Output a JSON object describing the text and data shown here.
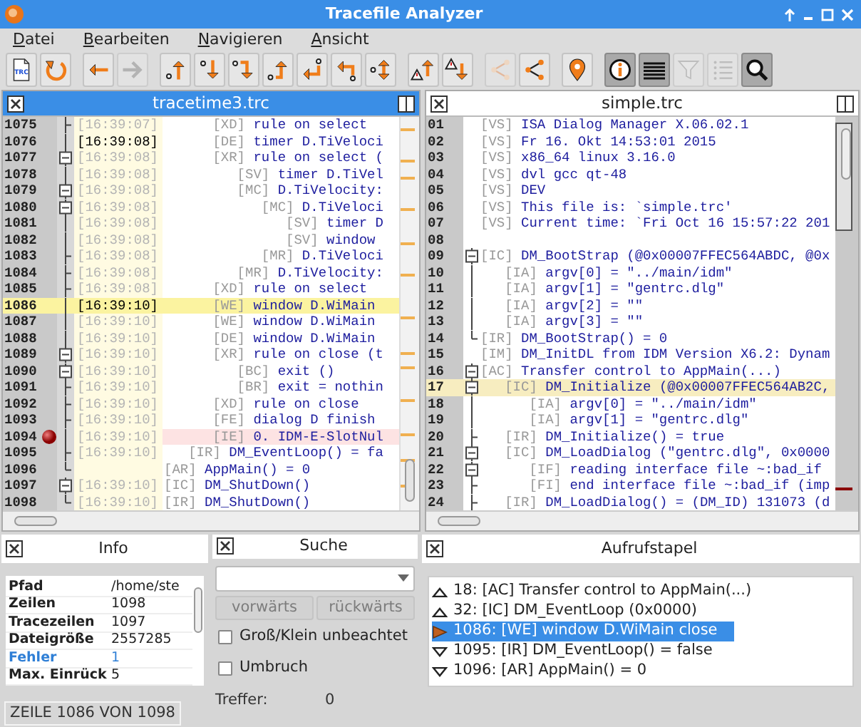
{
  "window": {
    "title": "Tracefile Analyzer"
  },
  "menu": [
    "Datei",
    "Bearbeiten",
    "Navigieren",
    "Ansicht"
  ],
  "toolbar": [
    [
      {
        "kind": "file",
        "label": "TRC",
        "pressed": false,
        "disabled": false
      },
      {
        "kind": "reload",
        "pressed": false,
        "disabled": false
      }
    ],
    [
      {
        "kind": "back",
        "pressed": false,
        "disabled": false
      },
      {
        "kind": "forward",
        "pressed": false,
        "disabled": true
      }
    ],
    [
      {
        "kind": "up-step",
        "pressed": false,
        "disabled": false
      },
      {
        "kind": "down-step",
        "pressed": false,
        "disabled": false
      },
      {
        "kind": "down-hook",
        "pressed": false,
        "disabled": false
      },
      {
        "kind": "up-hook",
        "pressed": false,
        "disabled": false
      },
      {
        "kind": "return",
        "pressed": false,
        "disabled": false
      },
      {
        "kind": "back-hook",
        "pressed": false,
        "disabled": false
      },
      {
        "kind": "updown",
        "pressed": false,
        "disabled": false
      }
    ],
    [
      {
        "kind": "warn-up",
        "pressed": false,
        "disabled": false
      },
      {
        "kind": "warn-down",
        "pressed": false,
        "disabled": false
      }
    ],
    [
      {
        "kind": "share",
        "pressed": false,
        "disabled": true
      },
      {
        "kind": "share",
        "pressed": false,
        "disabled": false
      }
    ],
    [
      {
        "kind": "pin",
        "pressed": false,
        "disabled": false
      }
    ],
    [
      {
        "kind": "info",
        "pressed": true,
        "disabled": false
      },
      {
        "kind": "lines",
        "pressed": true,
        "disabled": false
      },
      {
        "kind": "filter",
        "pressed": false,
        "disabled": true
      },
      {
        "kind": "list",
        "pressed": false,
        "disabled": true
      },
      {
        "kind": "search",
        "pressed": true,
        "disabled": false
      }
    ]
  ],
  "left_pane": {
    "title": "tracetime3.trc",
    "active": true,
    "rows": [
      {
        "num": "1075",
        "time": "[16:39:07]",
        "time_dim": true,
        "kind": "tick",
        "tag": "      [XD]",
        "text": "rule on select",
        "current": false,
        "error": false,
        "breakpoint": false
      },
      {
        "num": "1076",
        "time": "[16:39:08]",
        "time_dim": false,
        "kind": "line",
        "tag": "      [DE]",
        "text": "timer D.TiVeloci",
        "current": false,
        "error": false,
        "breakpoint": false
      },
      {
        "num": "1077",
        "time": "[16:39:08]",
        "time_dim": true,
        "kind": "box",
        "tag": "      [XR]",
        "text": "rule on select (",
        "current": false,
        "error": false,
        "breakpoint": false
      },
      {
        "num": "1078",
        "time": "[16:39:08]",
        "time_dim": true,
        "kind": "line",
        "tag": "         [SV]",
        "text": "timer D.TiVel",
        "current": false,
        "error": false,
        "breakpoint": false
      },
      {
        "num": "1079",
        "time": "[16:39:08]",
        "time_dim": true,
        "kind": "box",
        "tag": "         [MC]",
        "text": "D.TiVelocity:",
        "current": false,
        "error": false,
        "breakpoint": false
      },
      {
        "num": "1080",
        "time": "[16:39:08]",
        "time_dim": true,
        "kind": "box",
        "tag": "            [MC]",
        "text": "D.TiVeloci",
        "current": false,
        "error": false,
        "breakpoint": false
      },
      {
        "num": "1081",
        "time": "[16:39:08]",
        "time_dim": true,
        "kind": "line",
        "tag": "               [SV]",
        "text": "timer D",
        "current": false,
        "error": false,
        "breakpoint": false
      },
      {
        "num": "1082",
        "time": "[16:39:08]",
        "time_dim": true,
        "kind": "line",
        "tag": "               [SV]",
        "text": "window",
        "current": false,
        "error": false,
        "breakpoint": false
      },
      {
        "num": "1083",
        "time": "[16:39:08]",
        "time_dim": true,
        "kind": "tick",
        "tag": "            [MR]",
        "text": "D.TiVeloci",
        "current": false,
        "error": false,
        "breakpoint": false
      },
      {
        "num": "1084",
        "time": "[16:39:08]",
        "time_dim": true,
        "kind": "tick",
        "tag": "         [MR]",
        "text": "D.TiVelocity:",
        "current": false,
        "error": false,
        "breakpoint": false
      },
      {
        "num": "1085",
        "time": "[16:39:08]",
        "time_dim": true,
        "kind": "tick",
        "tag": "      [XD]",
        "text": "rule on select",
        "current": false,
        "error": false,
        "breakpoint": false
      },
      {
        "num": "1086",
        "time": "[16:39:10]",
        "time_dim": false,
        "kind": "line",
        "tag": "      [WE]",
        "text": "window D.WiMain",
        "current": true,
        "error": false,
        "breakpoint": false
      },
      {
        "num": "1087",
        "time": "[16:39:10]",
        "time_dim": true,
        "kind": "line",
        "tag": "      [WE]",
        "text": "window D.WiMain",
        "current": false,
        "error": false,
        "breakpoint": false
      },
      {
        "num": "1088",
        "time": "[16:39:10]",
        "time_dim": true,
        "kind": "line",
        "tag": "      [DE]",
        "text": "window D.WiMain",
        "current": false,
        "error": false,
        "breakpoint": false
      },
      {
        "num": "1089",
        "time": "[16:39:10]",
        "time_dim": true,
        "kind": "box",
        "tag": "      [XR]",
        "text": "rule on close (t",
        "current": false,
        "error": false,
        "breakpoint": false
      },
      {
        "num": "1090",
        "time": "[16:39:10]",
        "time_dim": true,
        "kind": "box",
        "tag": "         [BC]",
        "text": "exit ()",
        "current": false,
        "error": false,
        "breakpoint": false
      },
      {
        "num": "1091",
        "time": "[16:39:10]",
        "time_dim": true,
        "kind": "tick",
        "tag": "         [BR]",
        "text": "exit = nothin",
        "current": false,
        "error": false,
        "breakpoint": false
      },
      {
        "num": "1092",
        "time": "[16:39:10]",
        "time_dim": true,
        "kind": "tick",
        "tag": "      [XD]",
        "text": "rule on close",
        "current": false,
        "error": false,
        "breakpoint": false
      },
      {
        "num": "1093",
        "time": "[16:39:10]",
        "time_dim": true,
        "kind": "tick",
        "tag": "      [FE]",
        "text": "dialog D finish",
        "current": false,
        "error": false,
        "breakpoint": false
      },
      {
        "num": "1094",
        "time": "[16:39:10]",
        "time_dim": true,
        "kind": "line",
        "tag": "      [IE]",
        "text": "0. IDM-E-SlotNul",
        "current": false,
        "error": true,
        "breakpoint": true
      },
      {
        "num": "1095",
        "time": "[16:39:10]",
        "time_dim": true,
        "kind": "tick",
        "tag": "   [IR]",
        "text": "DM_EventLoop() = fa",
        "current": false,
        "error": false,
        "breakpoint": false
      },
      {
        "num": "1096",
        "kind": "end",
        "tag": "[AR]",
        "text": "AppMain() = 0",
        "current": false,
        "error": false,
        "breakpoint": false
      },
      {
        "num": "1097",
        "time": "[16:39:10]",
        "time_dim": true,
        "kind": "box",
        "tag": "[IC]",
        "text": "DM_ShutDown()",
        "current": false,
        "error": false,
        "breakpoint": false
      },
      {
        "num": "1098",
        "time": "[16:39:10]",
        "time_dim": true,
        "kind": "end",
        "tag": "[IR]",
        "text": "DM_ShutDown()",
        "current": false,
        "error": false,
        "breakpoint": false
      }
    ]
  },
  "right_pane": {
    "title": "simple.trc",
    "active": false,
    "rows": [
      {
        "num": "01",
        "kind": "none",
        "tag": "[VS]",
        "text": "ISA Dialog Manager X.06.02.1",
        "current": false
      },
      {
        "num": "02",
        "kind": "none",
        "tag": "[VS]",
        "text": "Fr 16. Okt 14:53:01 2015",
        "current": false
      },
      {
        "num": "03",
        "kind": "none",
        "tag": "[VS]",
        "text": "x86_64 linux 3.16.0",
        "current": false
      },
      {
        "num": "04",
        "kind": "none",
        "tag": "[VS]",
        "text": "dvl gcc qt-48",
        "current": false
      },
      {
        "num": "05",
        "kind": "none",
        "tag": "[VS]",
        "text": "DEV",
        "current": false
      },
      {
        "num": "06",
        "kind": "none",
        "tag": "[VS]",
        "text": "This file is: `simple.trc'",
        "current": false
      },
      {
        "num": "07",
        "kind": "none",
        "tag": "[VS]",
        "text": "Current time: `Fri Oct 16 15:57:22 201",
        "current": false
      },
      {
        "num": "08",
        "kind": "none",
        "current": false
      },
      {
        "num": "09",
        "kind": "box",
        "tag": "[IC]",
        "text": "DM_BootStrap (@0x00007FFEC564ABDC, @0x",
        "current": false
      },
      {
        "num": "10",
        "kind": "line",
        "tag": "   [IA]",
        "text": "argv[0] = \"../main/idm\"",
        "current": false
      },
      {
        "num": "11",
        "kind": "line",
        "tag": "   [IA]",
        "text": "argv[1] = \"gentrc.dlg\"",
        "current": false
      },
      {
        "num": "12",
        "kind": "line",
        "tag": "   [IA]",
        "text": "argv[2] = \"\"",
        "current": false
      },
      {
        "num": "13",
        "kind": "line",
        "tag": "   [IA]",
        "text": "argv[3] = \"\"",
        "current": false
      },
      {
        "num": "14",
        "kind": "end",
        "tag": "[IR]",
        "text": "DM_BootStrap() = 0",
        "current": false
      },
      {
        "num": "15",
        "kind": "none",
        "tag": "[IM]",
        "text": "DM_InitDL from IDM Version X6.2: Dynam",
        "current": false
      },
      {
        "num": "16",
        "kind": "box",
        "tag": "[AC]",
        "text": "Transfer control to AppMain(...)",
        "current": false
      },
      {
        "num": "17",
        "kind": "box",
        "tag": "   [IC]",
        "text": "DM_Initialize (@0x00007FFEC564AB2C,",
        "current": true
      },
      {
        "num": "18",
        "kind": "line",
        "tag": "      [IA]",
        "text": "argv[0] = \"../main/idm\"",
        "current": false
      },
      {
        "num": "19",
        "kind": "line",
        "tag": "      [IA]",
        "text": "argv[1] = \"gentrc.dlg\"",
        "current": false
      },
      {
        "num": "20",
        "kind": "tick",
        "tag": "   [IR]",
        "text": "DM_Initialize() = true",
        "current": false
      },
      {
        "num": "21",
        "kind": "box",
        "tag": "   [IC]",
        "text": "DM_LoadDialog (\"gentrc.dlg\", 0x0000",
        "current": false
      },
      {
        "num": "22",
        "kind": "box",
        "tag": "      [IF]",
        "text": "reading interface file ~:bad_if",
        "current": false
      },
      {
        "num": "23",
        "kind": "tick",
        "tag": "      [FI]",
        "text": "end interface file ~:bad_if (imp",
        "current": false
      },
      {
        "num": "24",
        "kind": "tick",
        "tag": "   [IR]",
        "text": "DM_LoadDialog() = (DM_ID) 131073 (d",
        "current": false
      }
    ]
  },
  "info": {
    "title": "Info",
    "rows": [
      {
        "label": "Pfad",
        "value": "/home/ste",
        "alert": false
      },
      {
        "label": "Zeilen",
        "value": "1098",
        "alert": false
      },
      {
        "label": "Tracezeilen",
        "value": "1097",
        "alert": false
      },
      {
        "label": "Dateigröße",
        "value": "2557285",
        "alert": false
      },
      {
        "label": "Fehler",
        "value": "1",
        "alert": true
      },
      {
        "label": "Max. Einrück",
        "value": "5",
        "alert": false
      }
    ]
  },
  "search": {
    "title": "Suche",
    "buttons": [
      {
        "label": "vorwärts",
        "disabled": true
      },
      {
        "label": "rückwärts",
        "disabled": true
      }
    ],
    "options": [
      {
        "label": "Groß/Klein unbeachtet",
        "checked": false
      },
      {
        "label": "Umbruch",
        "checked": false
      }
    ],
    "hits_label": "Treffer:",
    "hits": "0"
  },
  "call_stack": {
    "title": "Aufrufstapel",
    "items": [
      {
        "text": "18: [AC] Transfer control to AppMain(...)",
        "kind": "up",
        "selected": false
      },
      {
        "text": "32: [IC] DM_EventLoop (0x0000)",
        "kind": "up",
        "selected": false
      },
      {
        "text": "1086: [WE] window D.WiMain close",
        "kind": "current",
        "selected": true
      },
      {
        "text": "1095: [IR] DM_EventLoop() = false",
        "kind": "down",
        "selected": false
      },
      {
        "text": "1096: [AR] AppMain() = 0",
        "kind": "down",
        "selected": false
      }
    ]
  },
  "status_bar": "ZEILE 1086 VON 1098"
}
